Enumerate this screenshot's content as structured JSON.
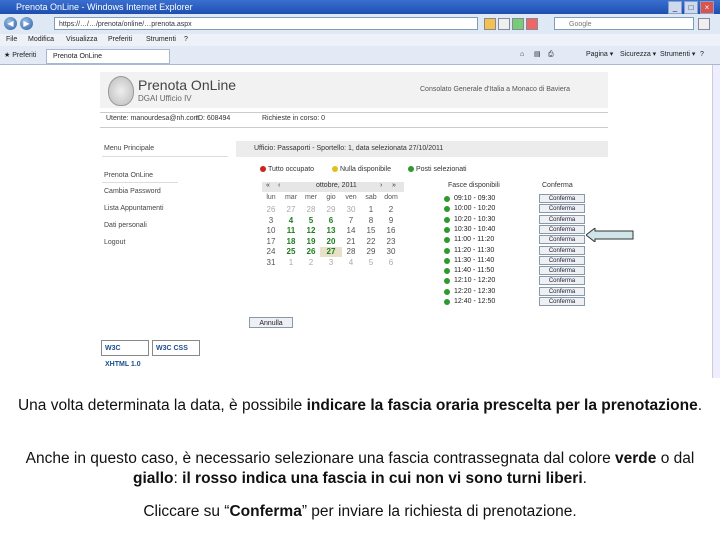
{
  "browser": {
    "title": "Prenota OnLine - Windows Internet Explorer",
    "url": "https://…/…/prenota/online/…prenota.aspx",
    "search_placeholder": "Google",
    "menu": [
      "File",
      "Modifica",
      "Visualizza",
      "Preferiti",
      "Strumenti",
      "?"
    ],
    "favorites_label": "Preferiti",
    "tab_label": "Prenota OnLine",
    "commands": [
      "Pagina ▾",
      "Sicurezza ▾",
      "Strumenti ▾",
      "?"
    ]
  },
  "header": {
    "brand": "Prenota OnLine",
    "subtitle": "DGAI Ufficio IV",
    "consulate": "Consolato Generale d'Italia a Monaco di Baviera",
    "user_label": "Utente: manourdesa@nh.com",
    "id_label": "ID: 608494",
    "requests_label": "Richieste in corso: 0"
  },
  "sidebar": {
    "title": "Menu Principale",
    "items": [
      "Prenota OnLine",
      "Cambia Password",
      "Lista Appuntamenti",
      "Dati personali",
      "Logout"
    ]
  },
  "main": {
    "info": "Ufficio: Passaporti - Sportello: 1, data selezionata 27/10/2011",
    "legend": [
      "Tutto occupato",
      "Nulla disponibile",
      "Posti selezionati"
    ],
    "legend_colors": [
      "#d02020",
      "#e0c020",
      "#2e9a2e"
    ],
    "calendar": {
      "month": "ottobre, 2011",
      "days_of_week": [
        "lun",
        "mar",
        "mer",
        "gio",
        "ven",
        "sab",
        "dom"
      ],
      "weeks": [
        [
          "26",
          "27",
          "28",
          "29",
          "30",
          "1",
          "2"
        ],
        [
          "3",
          "4",
          "5",
          "6",
          "7",
          "8",
          "9"
        ],
        [
          "10",
          "11",
          "12",
          "13",
          "14",
          "15",
          "16"
        ],
        [
          "17",
          "18",
          "19",
          "20",
          "21",
          "22",
          "23"
        ],
        [
          "24",
          "25",
          "26",
          "27",
          "28",
          "29",
          "30"
        ],
        [
          "31",
          "1",
          "2",
          "3",
          "4",
          "5",
          "6"
        ]
      ]
    },
    "slots_header": "Fasce disponibili",
    "confirm_header": "Conferma",
    "slots": [
      "09:10 - 09:30",
      "10:00 - 10:20",
      "10:20 - 10:30",
      "10:30 - 10:40",
      "11:00 - 11:20",
      "11:20 - 11:30",
      "11:30 - 11:40",
      "11:40 - 11:50",
      "12:10 - 12:20",
      "12:20 - 12:30",
      "12:40 - 12:50"
    ],
    "confirm_label": "Conferma",
    "cancel_label": "Annulla",
    "badges": [
      "W3C XHTML 1.0",
      "W3C CSS"
    ]
  },
  "caption": {
    "p1_plain": "Una volta determinata la data, è possibile ",
    "p1_bold": "indicare la fascia oraria prescelta per la prenotazione",
    "p1_end": ".",
    "p2_a": "Anche in questo caso, è necessario selezionare una fascia contrassegnata dal colore ",
    "p2_b": "verde",
    "p2_c": " o dal ",
    "p2_d": "giallo",
    "p2_e": ": ",
    "p2_f": "il rosso indica una fascia in cui non vi sono turni liberi",
    "p2_g": ".",
    "p3_a": "Cliccare su “",
    "p3_b": "Conferma",
    "p3_c": "” per inviare la richiesta di prenotazione."
  }
}
